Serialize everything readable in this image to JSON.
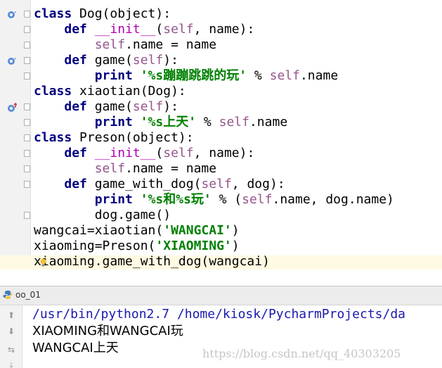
{
  "editor": {
    "lines": [
      [
        {
          "t": "class",
          "c": "kw"
        },
        {
          "t": " Dog(object):"
        }
      ],
      [
        {
          "t": "    "
        },
        {
          "t": "def",
          "c": "kw"
        },
        {
          "t": " "
        },
        {
          "t": "__init__",
          "c": "magic"
        },
        {
          "t": "("
        },
        {
          "t": "self",
          "c": "self"
        },
        {
          "t": ", name):"
        }
      ],
      [
        {
          "t": "        "
        },
        {
          "t": "self",
          "c": "self"
        },
        {
          "t": ".name = name"
        }
      ],
      [
        {
          "t": "    "
        },
        {
          "t": "def",
          "c": "kw"
        },
        {
          "t": " game("
        },
        {
          "t": "self",
          "c": "self"
        },
        {
          "t": "):"
        }
      ],
      [
        {
          "t": "        "
        },
        {
          "t": "print",
          "c": "kw"
        },
        {
          "t": " "
        },
        {
          "t": "'%s蹦蹦跳跳的玩'",
          "c": "str"
        },
        {
          "t": " % "
        },
        {
          "t": "self",
          "c": "self"
        },
        {
          "t": ".name"
        }
      ],
      [
        {
          "t": "class",
          "c": "kw"
        },
        {
          "t": " xiaotian(Dog):"
        }
      ],
      [
        {
          "t": "    "
        },
        {
          "t": "def",
          "c": "kw"
        },
        {
          "t": " game("
        },
        {
          "t": "self",
          "c": "self"
        },
        {
          "t": "):"
        }
      ],
      [
        {
          "t": "        "
        },
        {
          "t": "print",
          "c": "kw"
        },
        {
          "t": " "
        },
        {
          "t": "'%s上天'",
          "c": "str"
        },
        {
          "t": " % "
        },
        {
          "t": "self",
          "c": "self"
        },
        {
          "t": ".name"
        }
      ],
      [
        {
          "t": "class",
          "c": "kw"
        },
        {
          "t": " Preson(object):"
        }
      ],
      [
        {
          "t": "    "
        },
        {
          "t": "def",
          "c": "kw"
        },
        {
          "t": " "
        },
        {
          "t": "__init__",
          "c": "magic"
        },
        {
          "t": "("
        },
        {
          "t": "self",
          "c": "self"
        },
        {
          "t": ", name):"
        }
      ],
      [
        {
          "t": "        "
        },
        {
          "t": "self",
          "c": "self"
        },
        {
          "t": ".name = name"
        }
      ],
      [
        {
          "t": "    "
        },
        {
          "t": "def",
          "c": "kw"
        },
        {
          "t": " game_with_dog("
        },
        {
          "t": "self",
          "c": "self"
        },
        {
          "t": ", dog):"
        }
      ],
      [
        {
          "t": "        "
        },
        {
          "t": "print",
          "c": "kw"
        },
        {
          "t": " "
        },
        {
          "t": "'%s和%s玩'",
          "c": "str"
        },
        {
          "t": " % ("
        },
        {
          "t": "self",
          "c": "self"
        },
        {
          "t": ".name, dog.name)"
        }
      ],
      [
        {
          "t": "        dog.game()"
        }
      ],
      [
        {
          "t": "wangcai=xiaotian("
        },
        {
          "t": "'WANGCAI'",
          "c": "str"
        },
        {
          "t": ")"
        }
      ],
      [
        {
          "t": "xiaoming=Preson("
        },
        {
          "t": "'XIAOMING'",
          "c": "str"
        },
        {
          "t": ")"
        }
      ],
      [
        {
          "t": "xiaoming.game_with_dog(wangcai)"
        }
      ]
    ]
  },
  "run_panel": {
    "title": "oo_01"
  },
  "console": {
    "command": "/usr/bin/python2.7 /home/kiosk/PycharmProjects/da",
    "output_1": "XIAOMING和WANGCAI玩",
    "output_2": "WANGCAI上天"
  },
  "watermark": "https://blog.csdn.net/qq_40303205",
  "colors": {
    "keyword": "#000080",
    "self": "#94558d",
    "string": "#008000",
    "magic": "#b200b2",
    "console_path": "#1a1ab0"
  }
}
